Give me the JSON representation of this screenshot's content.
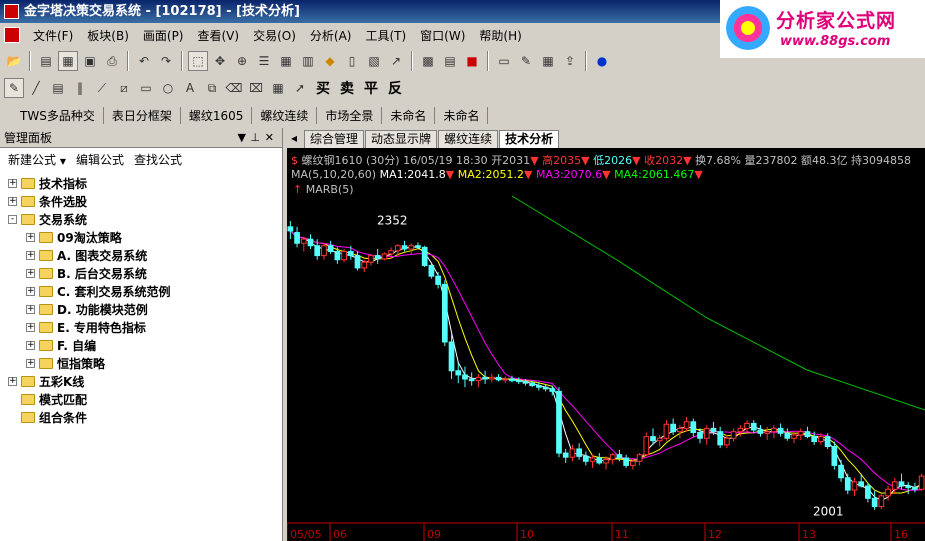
{
  "window": {
    "title": "金字塔决策交易系统 - [102178] - [技术分析]"
  },
  "logo": {
    "text": "分析家公式网",
    "url": "www.88gs.com"
  },
  "menu": [
    "文件(F)",
    "板块(B)",
    "画面(P)",
    "查看(V)",
    "交易(O)",
    "分析(A)",
    "工具(T)",
    "窗口(W)",
    "帮助(H)"
  ],
  "toolbar2": {
    "buy": "买",
    "sell": "卖",
    "close": "平",
    "reverse": "反"
  },
  "quick_tabs": [
    "TWS多品种交",
    "表日分框架",
    "螺纹1605",
    "螺纹连续",
    "市场全景",
    "未命名",
    "未命名"
  ],
  "panel": {
    "title": "管理面板",
    "new_formula": "新建公式",
    "edit_formula": "编辑公式",
    "find_formula": "查找公式",
    "tree": [
      {
        "level": 0,
        "label": "技术指标",
        "exp": "+"
      },
      {
        "level": 0,
        "label": "条件选股",
        "exp": "+"
      },
      {
        "level": 0,
        "label": "交易系统",
        "exp": "-"
      },
      {
        "level": 1,
        "label": "09淘汰策略",
        "exp": "+"
      },
      {
        "level": 1,
        "label": "A. 图表交易系统",
        "exp": "+"
      },
      {
        "level": 1,
        "label": "B. 后台交易系统",
        "exp": "+"
      },
      {
        "level": 1,
        "label": "C. 套利交易系统范例",
        "exp": "+"
      },
      {
        "level": 1,
        "label": "D. 功能模块范例",
        "exp": "+"
      },
      {
        "level": 1,
        "label": "E. 专用特色指标",
        "exp": "+"
      },
      {
        "level": 1,
        "label": "F. 自编",
        "exp": "+"
      },
      {
        "level": 1,
        "label": "恒指策略",
        "exp": "+"
      },
      {
        "level": 0,
        "label": "五彩K线",
        "exp": "+"
      },
      {
        "level": 0,
        "label": "模式匹配",
        "exp": ""
      },
      {
        "level": 0,
        "label": "组合条件",
        "exp": ""
      }
    ]
  },
  "chart_tabs": [
    "综合管理",
    "动态显示牌",
    "螺纹连续",
    "技术分析"
  ],
  "chart_info": {
    "symbol": "螺纹钢1610 (30分)",
    "datetime": "16/05/19 18:30",
    "open": "开2031",
    "high": "高2035",
    "low": "低2026",
    "close": "收2032",
    "turnover": "换7.68%",
    "volume": "量237802",
    "amount": "额48.3亿",
    "hold": "持3094858",
    "ma_label": "MA(5,10,20,60)",
    "ma1": "MA1:2041.8",
    "ma2": "MA2:2051.2",
    "ma3": "MA3:2070.6",
    "ma4": "MA4:2061.467",
    "marb": "MARB(5)",
    "high_mark": "2352",
    "low_mark": "2001"
  },
  "chart_data": {
    "type": "candlestick",
    "x_ticks": [
      "05/05",
      "06",
      "09",
      "10",
      "11",
      "12",
      "13",
      "16"
    ],
    "y_range": [
      1985,
      2380
    ],
    "annotations": [
      "2352",
      "2001"
    ],
    "candles": [
      [
        2345,
        2352,
        2330,
        2340
      ],
      [
        2338,
        2345,
        2320,
        2325
      ],
      [
        2325,
        2332,
        2315,
        2330
      ],
      [
        2330,
        2336,
        2318,
        2322
      ],
      [
        2322,
        2330,
        2305,
        2310
      ],
      [
        2310,
        2325,
        2305,
        2322
      ],
      [
        2322,
        2328,
        2312,
        2315
      ],
      [
        2315,
        2320,
        2300,
        2305
      ],
      [
        2305,
        2318,
        2302,
        2315
      ],
      [
        2315,
        2322,
        2305,
        2310
      ],
      [
        2310,
        2315,
        2292,
        2295
      ],
      [
        2295,
        2305,
        2290,
        2302
      ],
      [
        2302,
        2312,
        2298,
        2310
      ],
      [
        2310,
        2318,
        2300,
        2306
      ],
      [
        2306,
        2314,
        2304,
        2312
      ],
      [
        2312,
        2320,
        2306,
        2316
      ],
      [
        2316,
        2324,
        2310,
        2322
      ],
      [
        2322,
        2328,
        2315,
        2318
      ],
      [
        2318,
        2325,
        2312,
        2322
      ],
      [
        2322,
        2326,
        2318,
        2320
      ],
      [
        2320,
        2322,
        2296,
        2298
      ],
      [
        2298,
        2302,
        2282,
        2285
      ],
      [
        2285,
        2290,
        2270,
        2275
      ],
      [
        2275,
        2280,
        2200,
        2205
      ],
      [
        2205,
        2215,
        2160,
        2170
      ],
      [
        2170,
        2180,
        2155,
        2165
      ],
      [
        2165,
        2175,
        2150,
        2160
      ],
      [
        2160,
        2168,
        2152,
        2158
      ],
      [
        2158,
        2166,
        2150,
        2162
      ],
      [
        2162,
        2170,
        2154,
        2160
      ],
      [
        2160,
        2166,
        2156,
        2162
      ],
      [
        2162,
        2166,
        2157,
        2159
      ],
      [
        2159,
        2163,
        2155,
        2160
      ],
      [
        2160,
        2164,
        2156,
        2158
      ],
      [
        2158,
        2162,
        2154,
        2157
      ],
      [
        2157,
        2160,
        2152,
        2155
      ],
      [
        2155,
        2158,
        2150,
        2152
      ],
      [
        2152,
        2156,
        2146,
        2150
      ],
      [
        2150,
        2154,
        2145,
        2148
      ],
      [
        2148,
        2152,
        2140,
        2145
      ],
      [
        2145,
        2150,
        2065,
        2070
      ],
      [
        2070,
        2075,
        2058,
        2065
      ],
      [
        2065,
        2080,
        2060,
        2075
      ],
      [
        2075,
        2082,
        2062,
        2066
      ],
      [
        2066,
        2072,
        2055,
        2060
      ],
      [
        2060,
        2068,
        2052,
        2064
      ],
      [
        2064,
        2070,
        2056,
        2058
      ],
      [
        2058,
        2066,
        2050,
        2062
      ],
      [
        2062,
        2070,
        2056,
        2068
      ],
      [
        2068,
        2074,
        2060,
        2064
      ],
      [
        2064,
        2068,
        2052,
        2055
      ],
      [
        2055,
        2062,
        2050,
        2060
      ],
      [
        2060,
        2070,
        2055,
        2068
      ],
      [
        2068,
        2095,
        2066,
        2090
      ],
      [
        2090,
        2100,
        2080,
        2085
      ],
      [
        2085,
        2092,
        2078,
        2088
      ],
      [
        2088,
        2110,
        2085,
        2105
      ],
      [
        2105,
        2112,
        2092,
        2096
      ],
      [
        2096,
        2104,
        2088,
        2100
      ],
      [
        2100,
        2114,
        2096,
        2108
      ],
      [
        2108,
        2112,
        2090,
        2095
      ],
      [
        2095,
        2100,
        2082,
        2088
      ],
      [
        2088,
        2104,
        2080,
        2100
      ],
      [
        2100,
        2108,
        2092,
        2096
      ],
      [
        2096,
        2102,
        2076,
        2080
      ],
      [
        2080,
        2092,
        2076,
        2088
      ],
      [
        2088,
        2100,
        2084,
        2096
      ],
      [
        2096,
        2104,
        2090,
        2100
      ],
      [
        2100,
        2110,
        2094,
        2106
      ],
      [
        2106,
        2110,
        2094,
        2098
      ],
      [
        2098,
        2104,
        2090,
        2094
      ],
      [
        2094,
        2102,
        2086,
        2096
      ],
      [
        2096,
        2104,
        2088,
        2100
      ],
      [
        2100,
        2106,
        2090,
        2094
      ],
      [
        2094,
        2100,
        2085,
        2088
      ],
      [
        2088,
        2096,
        2082,
        2092
      ],
      [
        2092,
        2100,
        2086,
        2096
      ],
      [
        2096,
        2102,
        2088,
        2090
      ],
      [
        2090,
        2096,
        2080,
        2084
      ],
      [
        2084,
        2094,
        2080,
        2090
      ],
      [
        2090,
        2094,
        2075,
        2078
      ],
      [
        2078,
        2084,
        2050,
        2055
      ],
      [
        2055,
        2062,
        2035,
        2040
      ],
      [
        2040,
        2045,
        2020,
        2025
      ],
      [
        2025,
        2040,
        2018,
        2035
      ],
      [
        2035,
        2045,
        2028,
        2030
      ],
      [
        2030,
        2034,
        2010,
        2015
      ],
      [
        2015,
        2024,
        2001,
        2005
      ],
      [
        2005,
        2020,
        2002,
        2018
      ],
      [
        2018,
        2030,
        2012,
        2026
      ],
      [
        2026,
        2040,
        2020,
        2035
      ],
      [
        2035,
        2045,
        2026,
        2030
      ],
      [
        2030,
        2035,
        2020,
        2028
      ],
      [
        2028,
        2034,
        2022,
        2026
      ],
      [
        2026,
        2045,
        2024,
        2042
      ]
    ],
    "series": [
      {
        "name": "MA1",
        "color": "#ffffff"
      },
      {
        "name": "MA2",
        "color": "#ffff00"
      },
      {
        "name": "MA3",
        "color": "#ff00ff"
      },
      {
        "name": "MA4",
        "color": "#00ff00"
      }
    ]
  },
  "colors": {
    "up": "#ff3333",
    "down": "#54ffff",
    "ma1": "#ffffff",
    "ma2": "#ffff00",
    "ma3": "#ff00ff",
    "ma4": "#00ff00"
  }
}
